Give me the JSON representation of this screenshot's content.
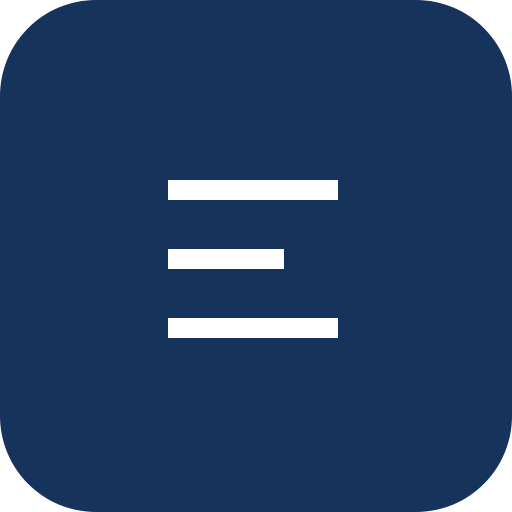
{
  "app_icon": {
    "icon": "menu-lines-icon",
    "background_color": "#16335c",
    "line_color": "#ffffff"
  }
}
